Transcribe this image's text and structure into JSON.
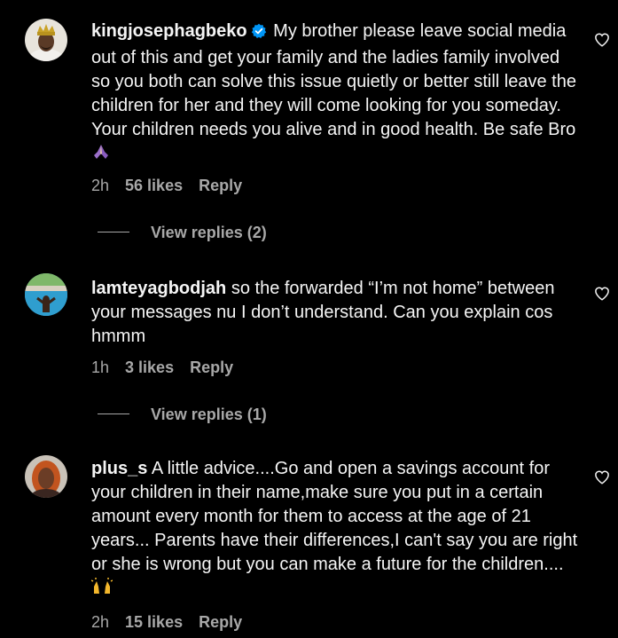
{
  "comments": [
    {
      "username": "kingjosephagbeko",
      "verified": true,
      "text": "My brother please leave social media out of this and get your family and the ladies family involved so you both can solve this issue quietly or better still leave the children for her and they will come looking for you someday. Your children needs you alive and in good health. Be safe Bro",
      "emoji": "praying-hands",
      "time": "2h",
      "likes": "56 likes",
      "reply_label": "Reply",
      "view_replies": "View replies (2)"
    },
    {
      "username": "lamteyagbodjah",
      "verified": false,
      "text": "so the forwarded “I’m not home” between your messages nu I don’t understand. Can you explain cos hmmm",
      "time": "1h",
      "likes": "3 likes",
      "reply_label": "Reply",
      "view_replies": "View replies (1)"
    },
    {
      "username": "plus_s",
      "verified": false,
      "text": "A little advice....Go and open a savings account for your children in their name,make sure you put in a certain amount every month for them to access at the age of 21 years... Parents have their differences,I can't say you are right or she is wrong but you can make a future for the children....",
      "emoji": "raising-hands",
      "time": "2h",
      "likes": "15 likes",
      "reply_label": "Reply"
    }
  ],
  "colors": {
    "background": "#000000",
    "text": "#f5f5f5",
    "secondary": "#a8a8a8",
    "verified": "#0095f6"
  }
}
